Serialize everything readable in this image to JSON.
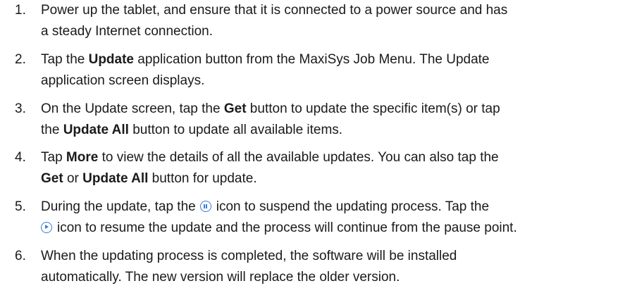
{
  "steps": [
    {
      "number": "1.",
      "line1": "Power up the tablet, and ensure that it is connected to a power source and has",
      "line2": "a steady Internet connection."
    },
    {
      "number": "2.",
      "pre": "Tap the ",
      "bold1": "Update",
      "mid": " application button from the MaxiSys Job Menu. The Update",
      "line2": "application screen displays."
    },
    {
      "number": "3.",
      "pre": "On the Update screen, tap the ",
      "bold1": "Get",
      "mid": " button to update the specific item(s) or tap",
      "line2_pre": "the ",
      "bold2": "Update All",
      "line2_post": " button to update all available items."
    },
    {
      "number": "4.",
      "pre": "Tap ",
      "bold1": "More",
      "mid": " to view the details of all the available updates. You can also tap the",
      "bold2": "Get",
      "line2_mid": " or ",
      "bold3": "Update All",
      "line2_post": " button for update."
    },
    {
      "number": "5.",
      "pre": "During the update, tap the",
      "icon1": "pause-icon",
      "mid": "icon to suspend the updating process. Tap the",
      "icon2": "play-icon",
      "line2": "icon to resume the update and the process will continue from the pause point."
    },
    {
      "number": "6.",
      "line1": "When the updating process is completed, the software will be installed",
      "line2": "automatically. The new version will replace the older version."
    }
  ]
}
